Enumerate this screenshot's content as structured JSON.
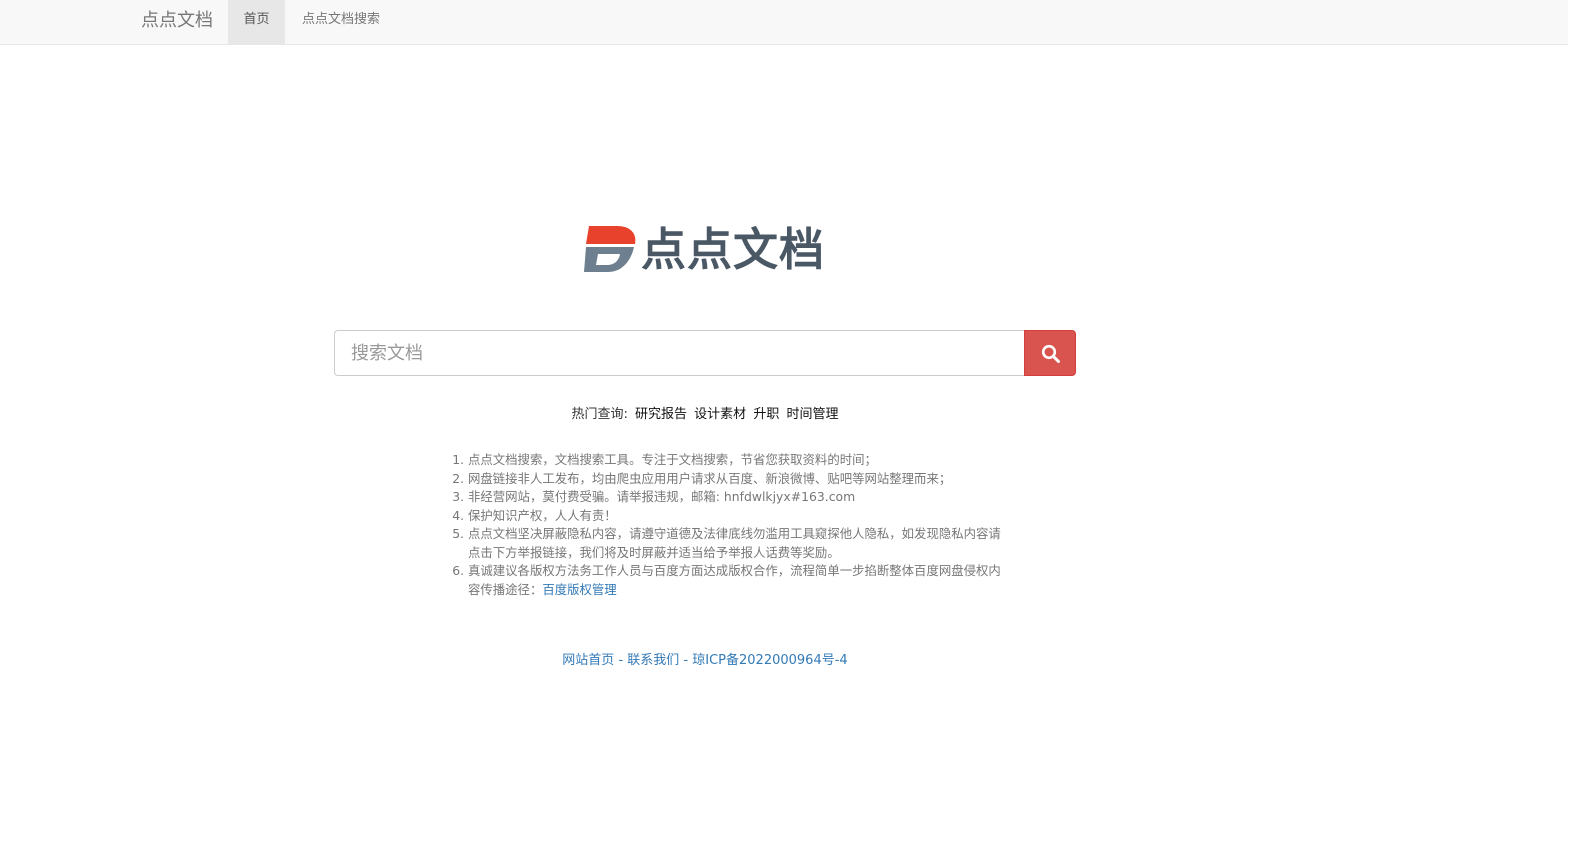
{
  "navbar": {
    "brand": "点点文档",
    "items": [
      {
        "label": "首页",
        "active": true
      },
      {
        "label": "点点文档搜索",
        "active": false
      }
    ],
    "background": "#f8f8f8"
  },
  "logo": {
    "text": "点点文档",
    "mark_letter": "D",
    "colors": {
      "red": "#e8412c",
      "slate": "#6e8090",
      "text": "#4a5866"
    }
  },
  "search": {
    "placeholder": "搜索文档",
    "value": "",
    "button_icon": "search-icon",
    "button_color": "#d9534f"
  },
  "hot": {
    "label": "热门查询:",
    "terms": [
      "研究报告",
      "设计素材",
      "升职",
      "时间管理"
    ]
  },
  "notes": [
    {
      "text": "点点文档搜索，文档搜索工具。专注于文档搜索，节省您获取资料的时间；"
    },
    {
      "text": "网盘链接非人工发布，均由爬虫应用用户请求从百度、新浪微博、贴吧等网站整理而来；"
    },
    {
      "text": "非经营网站，莫付费受骗。请举报违规，邮箱: hnfdwlkjyx#163.com"
    },
    {
      "text": "保护知识产权，人人有责！"
    },
    {
      "text": "点点文档坚决屏蔽隐私内容，请遵守道德及法律底线勿滥用工具窥探他人隐私，如发现隐私内容请点击下方举报链接，我们将及时屏蔽并适当给予举报人话费等奖励。"
    },
    {
      "text": "真诚建议各版权方法务工作人员与百度方面达成版权合作，流程简单一步掐断整体百度网盘侵权内容传播途径：",
      "link": "百度版权管理"
    }
  ],
  "footer": {
    "links": [
      "网站首页",
      "联系我们",
      "琼ICP备2022000964号-4"
    ],
    "separator": " - ",
    "color": "#337ab7"
  }
}
